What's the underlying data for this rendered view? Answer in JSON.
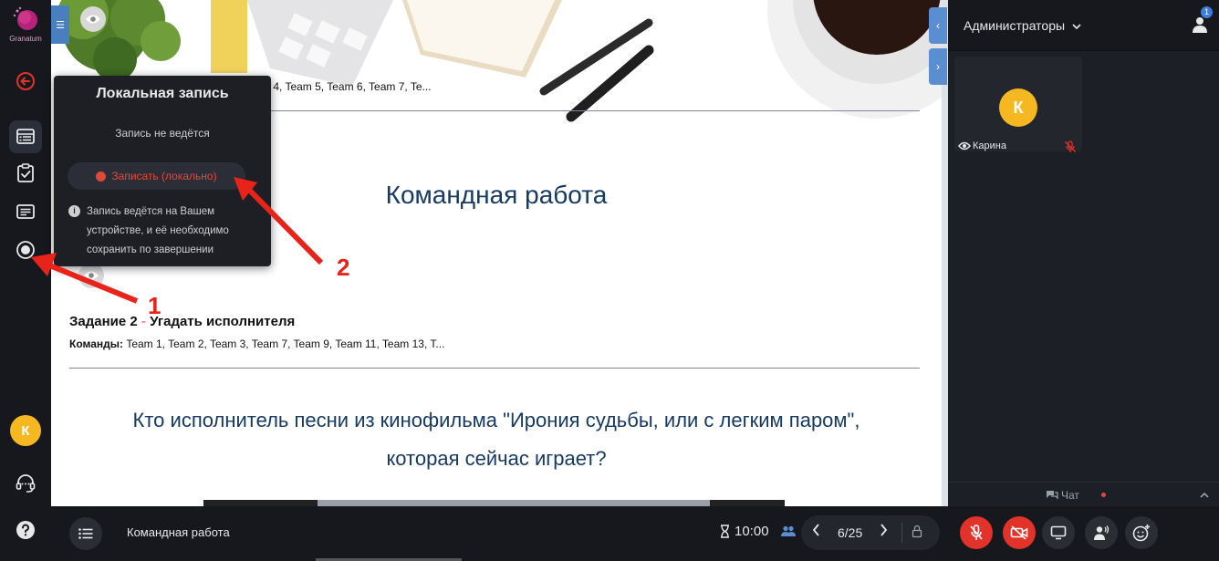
{
  "logo": {
    "text": "Granatum"
  },
  "popup": {
    "title": "Локальная запись",
    "status": "Запись не ведётся",
    "record_button": "Записать (локально)",
    "info_lines": [
      "Запись ведётся на Вашем",
      "устройстве, и её необходимо",
      "сохранить по завершении"
    ]
  },
  "slide": {
    "teams_line_1": "m 4, Team 5, Team 6, Team 7, Te...",
    "title": "Командная работа",
    "task2_prefix": "Задание 2",
    "task2_dash": " - ",
    "task2_name": "Угадать исполнителя",
    "teams2_label": "Команды:",
    "teams2_value": " Team 1, Team 2, Team 3, Team 7, Team 9, Team 11, Team 13, T...",
    "question_line_1": "Кто исполнитель песни из кинофильма \"Ирония судьбы, или с легким паром\",",
    "question_line_2": "которая сейчас играет?"
  },
  "annotations": {
    "arrow_1": "1",
    "arrow_2": "2"
  },
  "sidebar": {
    "avatar_letter": "К"
  },
  "right_panel": {
    "group_selector": "Администраторы",
    "participants_badge": "1",
    "tile": {
      "avatar_letter": "К",
      "name": "Карина"
    },
    "chat_label": "Чат"
  },
  "bottom_bar": {
    "title": "Командная работа",
    "timer": "10:00",
    "page_counter": "6/25"
  },
  "colors": {
    "accent_red": "#e2332a",
    "avatar_yellow": "#f5b820",
    "title_blue": "#163a63",
    "tab_blue": "#5b8ed0"
  }
}
